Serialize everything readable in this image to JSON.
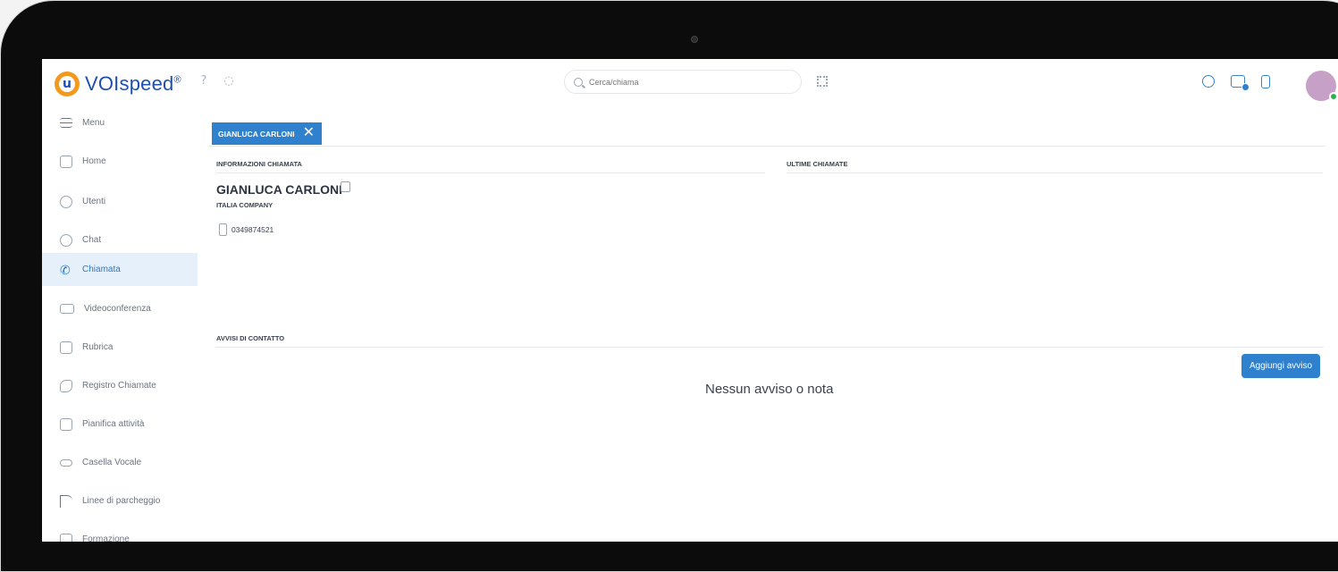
{
  "app": {
    "brand": "VOIspeed",
    "brand_mark": "®"
  },
  "search": {
    "placeholder": "Cerca/chiama"
  },
  "sidebar": {
    "items": [
      {
        "label": "Menu",
        "icon": "menu-icon"
      },
      {
        "label": "Home",
        "icon": "home-icon"
      },
      {
        "label": "Utenti",
        "icon": "users-icon"
      },
      {
        "label": "Chat",
        "icon": "chat-icon"
      },
      {
        "label": "Chiamata",
        "icon": "phone-icon",
        "active": true
      },
      {
        "label": "Videoconferenza",
        "icon": "video-icon"
      },
      {
        "label": "Rubrica",
        "icon": "contacts-icon"
      },
      {
        "label": "Registro Chiamate",
        "icon": "call-log-icon"
      },
      {
        "label": "Pianifica attività",
        "icon": "calendar-icon"
      },
      {
        "label": "Casella Vocale",
        "icon": "voicemail-icon"
      },
      {
        "label": "Linee di parcheggio",
        "icon": "parking-icon"
      },
      {
        "label": "Formazione",
        "icon": "training-icon"
      }
    ]
  },
  "main": {
    "tab_label": "GIANLUCA CARLONI",
    "call_info_header": "INFORMAZIONI CHIAMATA",
    "recent_calls_header": "ULTIME CHIAMATE",
    "contact_name": "GIANLUCA CARLONI",
    "company": "ITALIA COMPANY",
    "phone": "0349874521",
    "notices_header": "AVVISI DI CONTATTO",
    "add_notice_button": "Aggiungi avviso",
    "empty_message": "Nessun avviso o nota"
  },
  "colors": {
    "accent": "#2f80cd",
    "brand": "#1f4fb2",
    "logo_orange": "#f39a1e",
    "active_bg": "#e5f0fb",
    "presence": "#30b04a"
  }
}
